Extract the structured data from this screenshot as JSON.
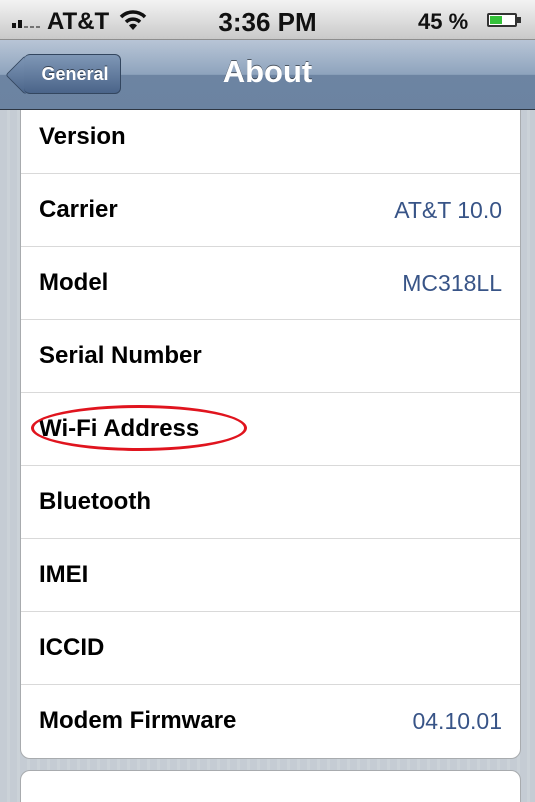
{
  "status_bar": {
    "carrier": "AT&T",
    "time": "3:36 PM",
    "battery_percent": "45 %",
    "battery_level": 0.45
  },
  "nav": {
    "back_label": "General",
    "title": "About"
  },
  "rows": [
    {
      "label": "Version",
      "value": ""
    },
    {
      "label": "Carrier",
      "value": "AT&T 10.0"
    },
    {
      "label": "Model",
      "value": "MC318LL"
    },
    {
      "label": "Serial Number",
      "value": ""
    },
    {
      "label": "Wi-Fi Address",
      "value": ""
    },
    {
      "label": "Bluetooth",
      "value": ""
    },
    {
      "label": "IMEI",
      "value": ""
    },
    {
      "label": "ICCID",
      "value": ""
    },
    {
      "label": "Modem Firmware",
      "value": "04.10.01"
    }
  ],
  "colors": {
    "value_text": "#385487",
    "highlight": "#e0141e"
  }
}
